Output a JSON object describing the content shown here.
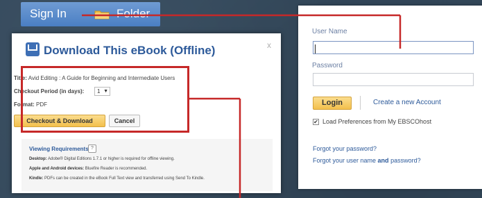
{
  "toolbar": {
    "signin_label": "Sign In",
    "folder_label": "Folder"
  },
  "dialog": {
    "title": "Download This eBook (Offline)",
    "close": "x",
    "title_label": "Title:",
    "title_value": "Avid Editing : A Guide for Beginning and Intermediate Users",
    "period_label": "Checkout Period (in days):",
    "period_value": "1",
    "format_label": "Format:",
    "format_value": "PDF",
    "checkout_button": "Checkout & Download",
    "cancel_button": "Cancel"
  },
  "requirements": {
    "title": "Viewing Requirements",
    "help": "?",
    "desktop_label": "Desktop:",
    "desktop_text": "Adobe® Digital Editions 1.7.1 or higher is required for offline viewing.",
    "mobile_label": "Apple and Android devices:",
    "mobile_text": "Bluefire Reader is recommended.",
    "kindle_label": "Kindle:",
    "kindle_text": "PDFs can be created in the eBook Full Text view and transferred using Send To Kindle."
  },
  "login": {
    "username_label": "User Name",
    "username_value": "",
    "password_label": "Password",
    "password_value": "",
    "login_button": "Login",
    "create_account": "Create a new Account",
    "checkbox_checked": "✔",
    "checkbox_label": "Load Preferences from My EBSCOhost",
    "forgot_password": "Forgot your password?",
    "forgot_username_prefix": "Forgot your user name ",
    "forgot_username_and": "and",
    "forgot_username_suffix": " password?"
  },
  "colors": {
    "background": "#34495c",
    "toolbar": "#4a7fc4",
    "accent_button": "#f3c04c",
    "highlight": "#c62828",
    "link": "#2d5a9a"
  },
  "icons": {
    "folder": "folder-icon",
    "download": "download-icon",
    "help": "help-icon",
    "check": "checkbox-icon"
  }
}
